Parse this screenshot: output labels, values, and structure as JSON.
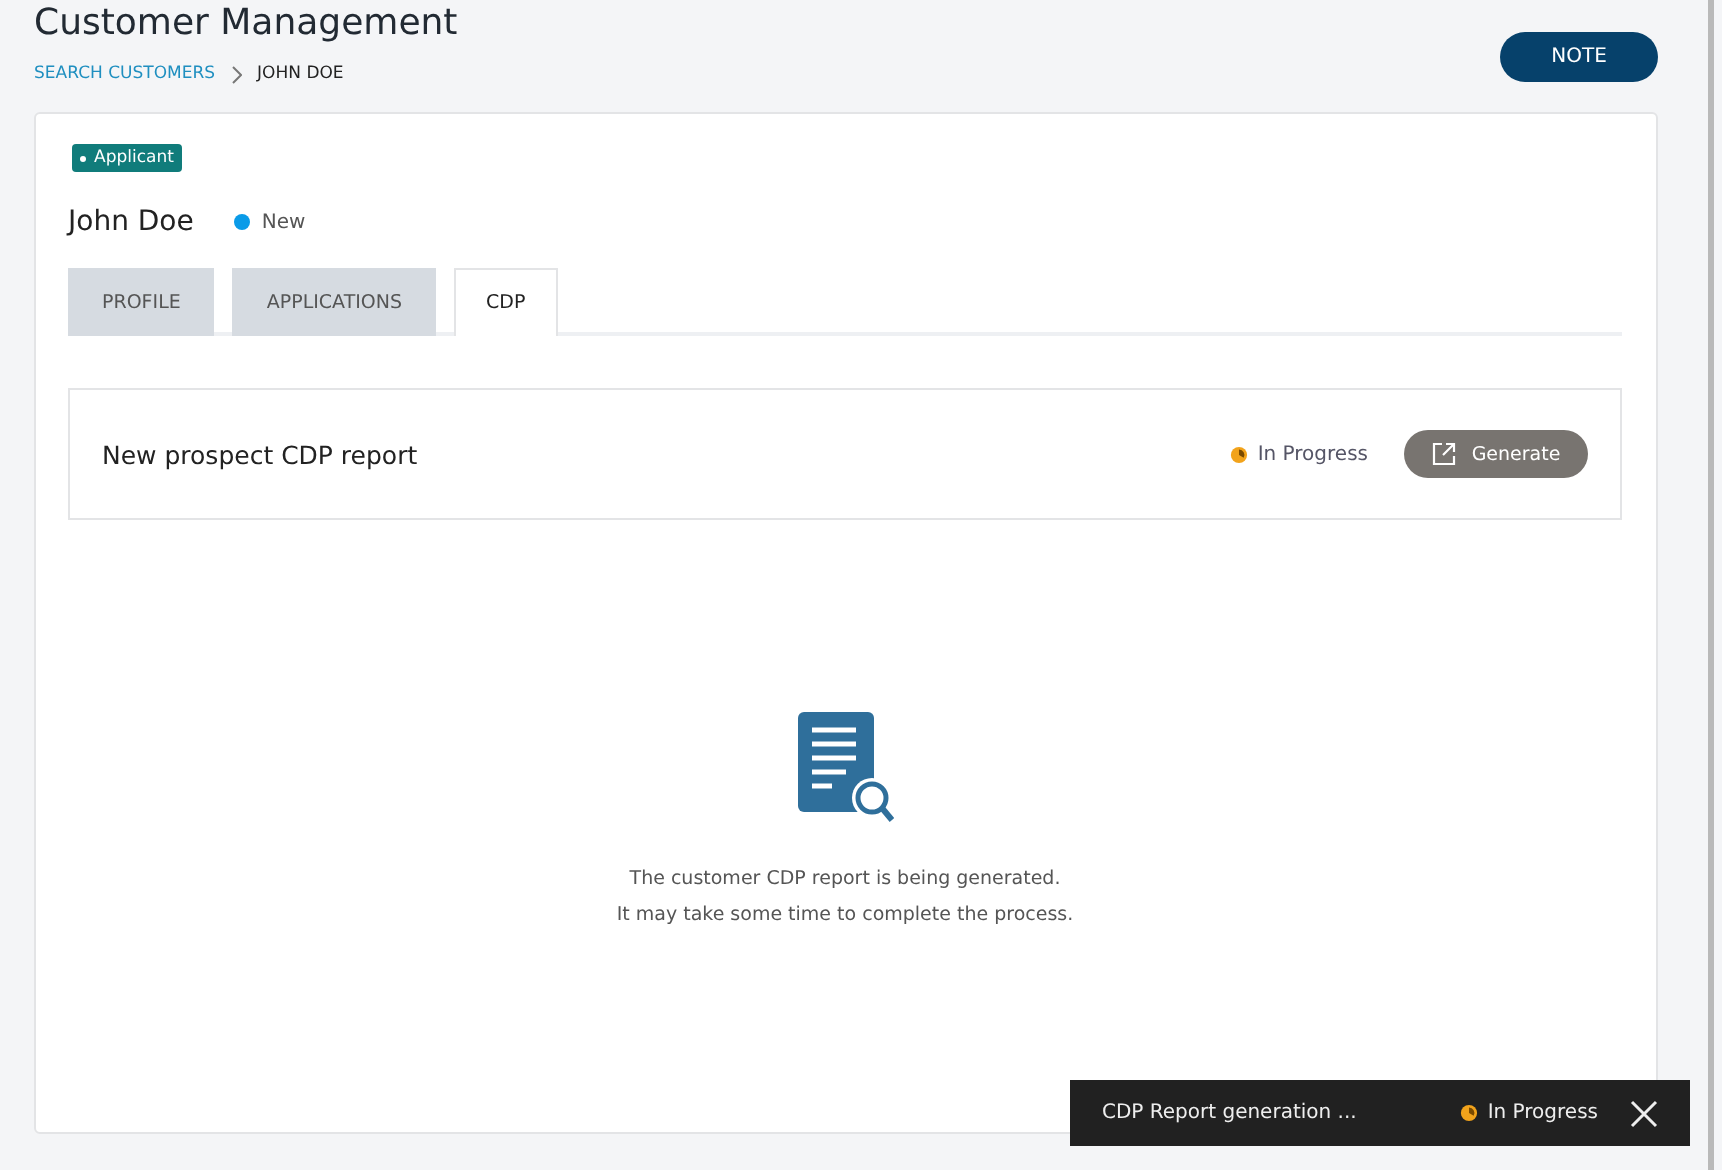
{
  "header": {
    "title": "Customer Management",
    "note_button": "NOTE"
  },
  "breadcrumbs": [
    {
      "label": "SEARCH CUSTOMERS",
      "kind": "link"
    },
    {
      "label": "JOHN DOE",
      "kind": "current"
    }
  ],
  "customer": {
    "tag": "Applicant",
    "name": "John Doe",
    "status": {
      "label": "New",
      "color": "#0a9be8"
    }
  },
  "tabs": [
    {
      "label": "PROFILE",
      "selected": false
    },
    {
      "label": "APPLICATIONS",
      "selected": false
    },
    {
      "label": "CDP",
      "selected": true
    }
  ],
  "report": {
    "title": "New prospect CDP report",
    "status": "In Progress",
    "button": "Generate"
  },
  "empty_state": {
    "lines": [
      "The customer CDP report is being generated.",
      "It may take some time to complete the process."
    ]
  },
  "toast": {
    "message": "CDP Report generation ...",
    "status": "In Progress"
  }
}
